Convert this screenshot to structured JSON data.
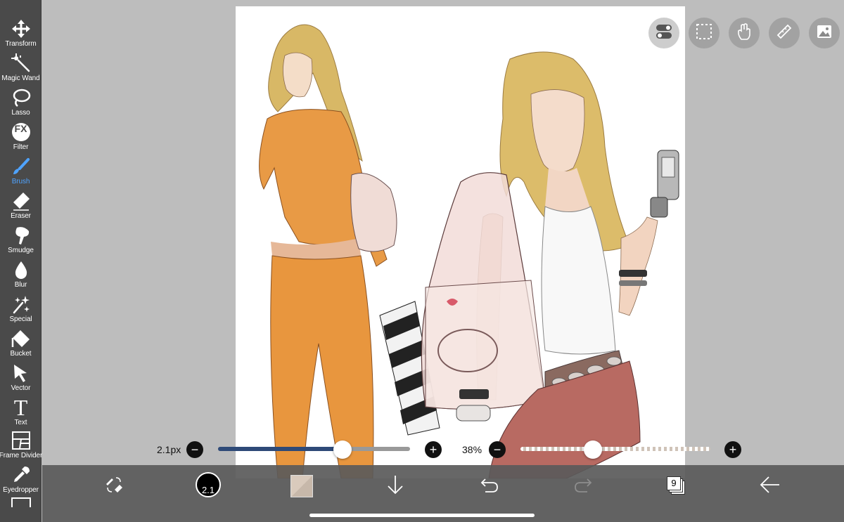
{
  "toolbar": {
    "active_color": "#4fa3ff",
    "tools": [
      {
        "label": "Transform",
        "icon": "move-arrows-icon"
      },
      {
        "label": "Magic Wand",
        "icon": "magic-wand-icon"
      },
      {
        "label": "Lasso",
        "icon": "lasso-icon"
      },
      {
        "label": "Filter",
        "icon": "fx-icon"
      },
      {
        "label": "Brush",
        "icon": "brush-icon",
        "active": true
      },
      {
        "label": "Eraser",
        "icon": "eraser-icon"
      },
      {
        "label": "Smudge",
        "icon": "smudge-icon"
      },
      {
        "label": "Blur",
        "icon": "drop-icon"
      },
      {
        "label": "Special",
        "icon": "sparkle-icon"
      },
      {
        "label": "Bucket",
        "icon": "bucket-icon"
      },
      {
        "label": "Vector",
        "icon": "cursor-arrow-icon"
      },
      {
        "label": "Text",
        "icon": "text-t-icon"
      },
      {
        "label": "Frame Divider",
        "icon": "frame-divider-icon"
      },
      {
        "label": "Eyedropper",
        "icon": "eyedropper-icon"
      }
    ]
  },
  "fx_text": "FX",
  "text_glyph": "T",
  "top_buttons": [
    {
      "name": "toggle-icon",
      "active": true
    },
    {
      "name": "selection-icon"
    },
    {
      "name": "hand-icon"
    },
    {
      "name": "ruler-icon"
    },
    {
      "name": "image-icon"
    }
  ],
  "brush_size": {
    "label": "2.1px",
    "value_fraction": 0.65,
    "minus": "−",
    "plus": "+"
  },
  "brush_opacity": {
    "label": "38%",
    "value_fraction": 0.38,
    "minus": "−",
    "plus": "+"
  },
  "bottom": {
    "brush_preview_text": "2.1",
    "layer_count": "9"
  }
}
